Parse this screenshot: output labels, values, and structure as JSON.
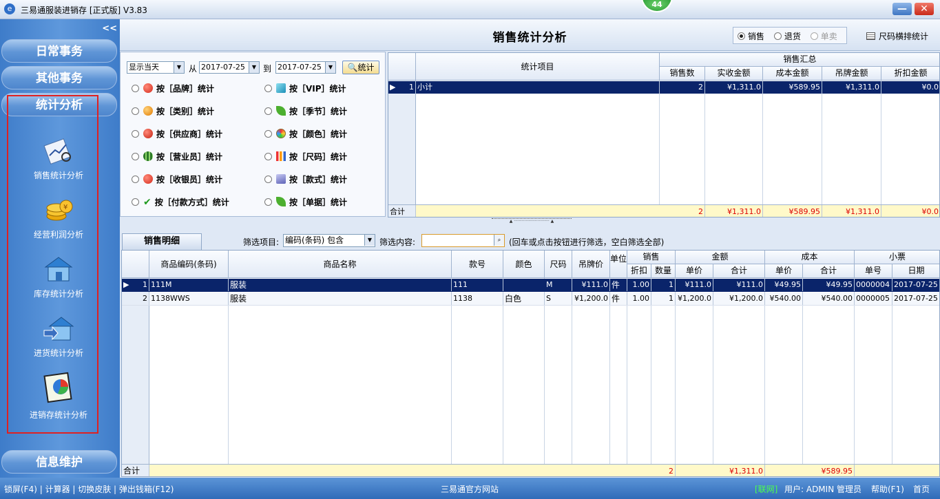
{
  "window": {
    "title": "三易通服装进销存 [正式版] V3.83",
    "badge": "44",
    "minimize": "—",
    "close": "✕"
  },
  "sidebar": {
    "collapse": "<<",
    "sections": [
      "日常事务",
      "其他事务",
      "统计分析",
      "信息维护"
    ],
    "items": [
      {
        "label": "销售统计分析",
        "icon": "sales-chart-icon"
      },
      {
        "label": "经营利润分析",
        "icon": "coins-icon"
      },
      {
        "label": "库存统计分析",
        "icon": "warehouse-icon"
      },
      {
        "label": "进货统计分析",
        "icon": "purchase-house-icon"
      },
      {
        "label": "进销存统计分析",
        "icon": "pie-chart-icon"
      }
    ]
  },
  "header": {
    "title": "销售统计分析",
    "modes": [
      "销售",
      "退货",
      "单卖"
    ],
    "selected_mode": "销售",
    "size_button": "尺码横排统计"
  },
  "filter": {
    "period": "显示当天",
    "from_label": "从",
    "from": "2017-07-25",
    "to_label": "到",
    "to": "2017-07-25",
    "stat_button": "统计",
    "options_left": [
      "按［品牌］统计",
      "按［类别］统计",
      "按［供应商］统计",
      "按［营业员］统计",
      "按［收银员］统计",
      "按［付款方式］统计"
    ],
    "options_right": [
      "按［VIP］统计",
      "按［季节］统计",
      "按［颜色］统计",
      "按［尺码］统计",
      "按［款式］统计",
      "按［单据］统计"
    ]
  },
  "summary": {
    "group_header": "销售汇总",
    "item_header": "统计项目",
    "columns": [
      "销售数",
      "实收金额",
      "成本金额",
      "吊牌金额",
      "折扣金额"
    ],
    "rows": [
      {
        "index": "1",
        "item": "小计",
        "values": [
          "2",
          "¥1,311.0",
          "¥589.95",
          "¥1,311.0",
          "¥0.0"
        ]
      }
    ],
    "total_label": "合计",
    "totals": [
      "2",
      "¥1,311.0",
      "¥589.95",
      "¥1,311.0",
      "¥0.0"
    ]
  },
  "splitter": "▲ ··························· ▲",
  "detail": {
    "tab": "销售明细",
    "filter_label": "筛选项目:",
    "filter_value": "编码(条码) 包含",
    "content_label": "筛选内容:",
    "content_value": "",
    "hint": "(回车或点击按钮进行筛选，空白筛选全部)",
    "headers": {
      "code": "商品编码(条码)",
      "name": "商品名称",
      "style": "款号",
      "color": "颜色",
      "size": "尺码",
      "tag_price": "吊牌价",
      "unit": "单位",
      "sale": "销售",
      "discount": "折扣",
      "qty": "数量",
      "amount": "金额",
      "unit_price": "单价",
      "subtotal": "合计",
      "cost": "成本",
      "cost_unit": "单价",
      "cost_total": "合计",
      "receipt": "小票",
      "receipt_no": "单号",
      "date": "日期"
    },
    "rows": [
      {
        "index": "1",
        "code": "111M",
        "name": "服装",
        "style": "111",
        "color": "",
        "size": "M",
        "tag_price": "¥111.0",
        "unit": "件",
        "discount": "1.00",
        "qty": "1",
        "price": "¥111.0",
        "amount": "¥111.0",
        "cost_unit": "¥49.95",
        "cost_total": "¥49.95",
        "receipt": "0000004",
        "date": "2017-07-25"
      },
      {
        "index": "2",
        "code": "1138WWS",
        "name": "服装",
        "style": "1138",
        "color": "白色",
        "size": "S",
        "tag_price": "¥1,200.0",
        "unit": "件",
        "discount": "1.00",
        "qty": "1",
        "price": "¥1,200.0",
        "amount": "¥1,200.0",
        "cost_unit": "¥540.00",
        "cost_total": "¥540.00",
        "receipt": "0000005",
        "date": "2017-07-25"
      }
    ],
    "total_label": "合计",
    "total_qty": "2",
    "total_amount": "¥1,311.0",
    "total_cost": "¥589.95"
  },
  "statusbar": {
    "left": "锁屏(F4) | 计算器 | 切换皮肤 | 弹出钱箱(F12)",
    "center": "三易通官方网站",
    "online": "[联网]",
    "user": "用户: ADMIN 管理员",
    "help": "帮助(F1)",
    "home": "首页"
  },
  "colors": {
    "selected_row": "#0a246a",
    "total_row": "#fff9c9",
    "online": "#4cff4c"
  }
}
